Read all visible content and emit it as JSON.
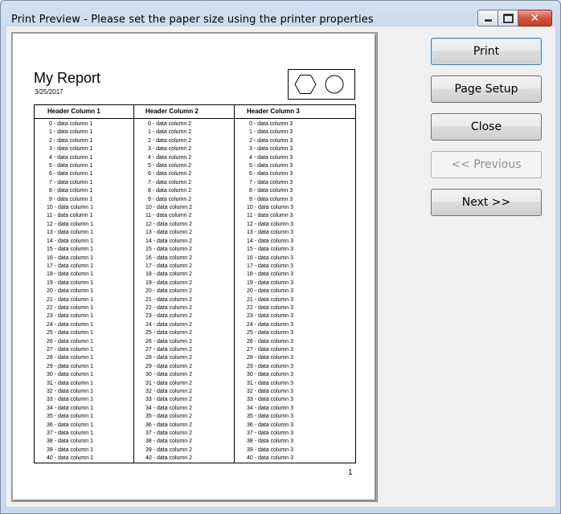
{
  "window": {
    "title": "Print Preview - Please set the paper size using the printer properties"
  },
  "report": {
    "title": "My Report",
    "date": "3/25/2017",
    "page_number": "1",
    "headers": [
      "Header Column 1",
      "Header Column 2",
      "Header Column 3"
    ],
    "columns": [
      [
        "0 - data column 1",
        "1 - data column 1",
        "2 - data column 1",
        "3 - data column 1",
        "4 - data column 1",
        "5 - data column 1",
        "6 - data column 1",
        "7 - data column 1",
        "8 - data column 1",
        "9 - data column 1",
        "10 - data column 1",
        "11 - data column 1",
        "12 - data column 1",
        "13 - data column 1",
        "14 - data column 1",
        "15 - data column 1",
        "16 - data column 1",
        "17 - data column 1",
        "18 - data column 1",
        "19 - data column 1",
        "20 - data column 1",
        "21 - data column 1",
        "22 - data column 1",
        "23 - data column 1",
        "24 - data column 1",
        "25 - data column 1",
        "26 - data column 1",
        "27 - data column 1",
        "28 - data column 1",
        "29 - data column 1",
        "30 - data column 1",
        "31 - data column 1",
        "32 - data column 1",
        "33 - data column 1",
        "34 - data column 1",
        "35 - data column 1",
        "36 - data column 1",
        "37 - data column 1",
        "38 - data column 1",
        "39 - data column 1",
        "40 - data column 1"
      ],
      [
        "0 - data column 2",
        "1 - data column 2",
        "2 - data column 2",
        "3 - data column 2",
        "4 - data column 2",
        "5 - data column 2",
        "6 - data column 2",
        "7 - data column 2",
        "8 - data column 2",
        "9 - data column 2",
        "10 - data column 2",
        "11 - data column 2",
        "12 - data column 2",
        "13 - data column 2",
        "14 - data column 2",
        "15 - data column 2",
        "16 - data column 2",
        "17 - data column 2",
        "18 - data column 2",
        "19 - data column 2",
        "20 - data column 2",
        "21 - data column 2",
        "22 - data column 2",
        "23 - data column 2",
        "24 - data column 2",
        "25 - data column 2",
        "26 - data column 2",
        "27 - data column 2",
        "28 - data column 2",
        "29 - data column 2",
        "30 - data column 2",
        "31 - data column 2",
        "32 - data column 2",
        "33 - data column 2",
        "34 - data column 2",
        "35 - data column 2",
        "36 - data column 2",
        "37 - data column 2",
        "38 - data column 2",
        "39 - data column 2",
        "40 - data column 2"
      ],
      [
        "0 - data column 3",
        "1 - data column 3",
        "2 - data column 3",
        "3 - data column 3",
        "4 - data column 3",
        "5 - data column 3",
        "6 - data column 3",
        "7 - data column 3",
        "8 - data column 3",
        "9 - data column 3",
        "10 - data column 3",
        "11 - data column 3",
        "12 - data column 3",
        "13 - data column 3",
        "14 - data column 3",
        "15 - data column 3",
        "16 - data column 3",
        "17 - data column 3",
        "18 - data column 3",
        "19 - data column 3",
        "20 - data column 3",
        "21 - data column 3",
        "22 - data column 3",
        "23 - data column 3",
        "24 - data column 3",
        "25 - data column 3",
        "26 - data column 3",
        "27 - data column 3",
        "28 - data column 3",
        "29 - data column 3",
        "30 - data column 3",
        "31 - data column 3",
        "32 - data column 3",
        "33 - data column 3",
        "34 - data column 3",
        "35 - data column 3",
        "36 - data column 3",
        "37 - data column 3",
        "38 - data column 3",
        "39 - data column 3",
        "40 - data column 3"
      ]
    ]
  },
  "buttons": {
    "print": "Print",
    "page_setup": "Page Setup",
    "close": "Close",
    "previous": "<< Previous",
    "next": "Next >>"
  },
  "icons": {
    "logo_left": "hexagon-icon",
    "logo_right": "circle-icon"
  },
  "colors": {
    "close_button": "#c2402a",
    "default_button_border": "#3c7fb1"
  }
}
